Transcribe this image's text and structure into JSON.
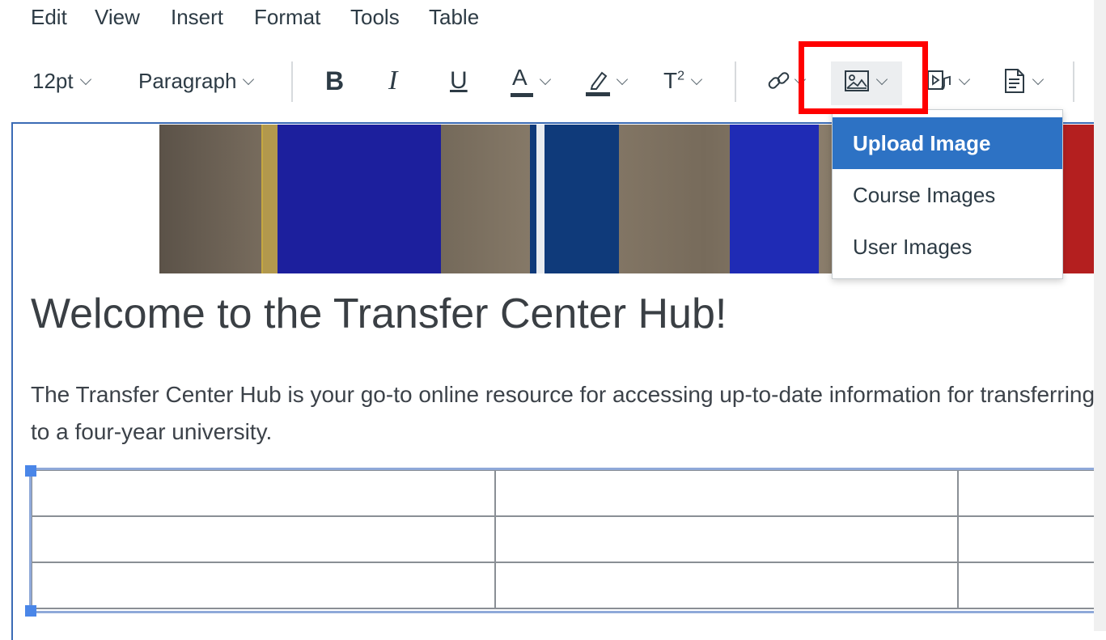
{
  "menubar": {
    "items": [
      "Edit",
      "View",
      "Insert",
      "Format",
      "Tools",
      "Table"
    ]
  },
  "toolbar": {
    "font_size": "12pt",
    "block_style": "Paragraph",
    "buttons": {
      "bold": "B",
      "italic": "I",
      "underline": "U",
      "text_color": "A",
      "superscript": "T",
      "superscript_mark": "2"
    }
  },
  "image_menu": {
    "items": [
      "Upload Image",
      "Course Images",
      "User Images"
    ],
    "active_index": 0
  },
  "content": {
    "heading": "Welcome to the Transfer Center Hub!",
    "paragraph": "The Transfer Center Hub is your go-to online resource for accessing up-to-date information for transferring to a four-year university."
  },
  "table": {
    "rows": 3,
    "cols": 3
  },
  "colors": {
    "accent": "#2d72c4",
    "highlight": "#ff0000",
    "editor_border": "#3b6bb5"
  }
}
